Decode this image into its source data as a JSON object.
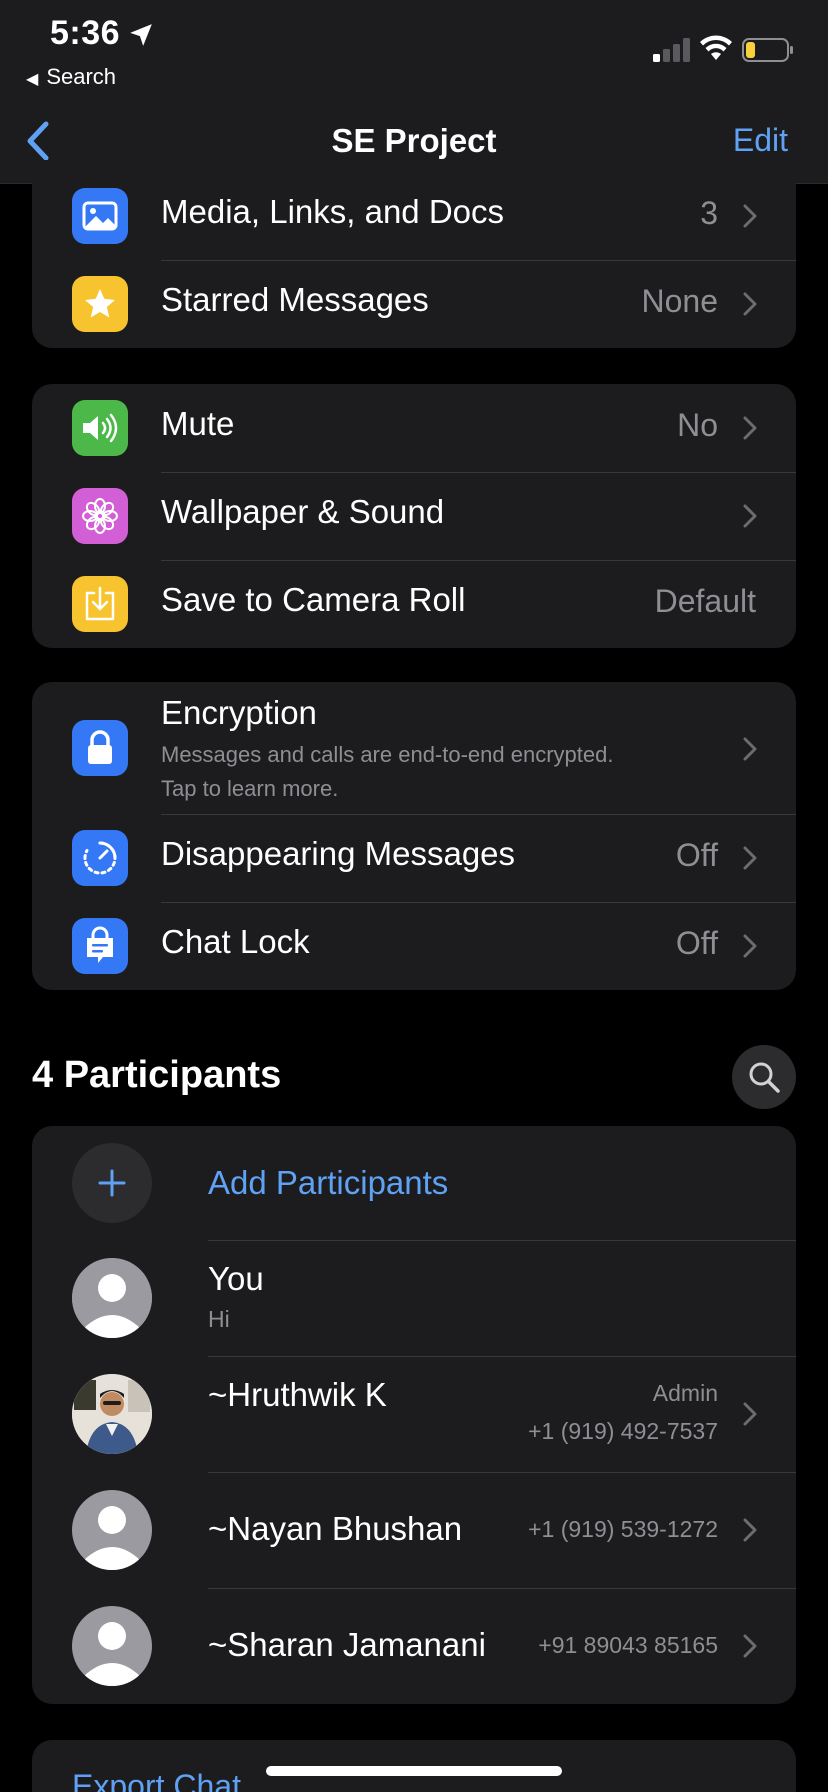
{
  "status_bar": {
    "time": "5:36",
    "back_app": "Search"
  },
  "nav": {
    "title": "SE Project",
    "edit": "Edit"
  },
  "group1": [
    {
      "label": "Media, Links, and Docs",
      "value": "3",
      "icon": "photo-icon",
      "color": "#3478f6"
    },
    {
      "label": "Starred Messages",
      "value": "None",
      "icon": "star-icon",
      "color": "#f7c32e"
    }
  ],
  "group2": [
    {
      "label": "Mute",
      "value": "No",
      "icon": "speaker-icon",
      "color": "#4cb84a"
    },
    {
      "label": "Wallpaper & Sound",
      "value": "",
      "icon": "flower-icon",
      "color": "#d35fd6"
    },
    {
      "label": "Save to Camera Roll",
      "value": "Default",
      "icon": "download-icon",
      "color": "#f7c32e"
    }
  ],
  "group3": {
    "encryption": {
      "label": "Encryption",
      "line1": "Messages and calls are end-to-end encrypted.",
      "line2": "Tap to learn more.",
      "icon": "lock-icon",
      "color": "#3478f6"
    },
    "disappearing": {
      "label": "Disappearing Messages",
      "value": "Off",
      "icon": "timer-icon",
      "color": "#3478f6"
    },
    "chat_lock": {
      "label": "Chat Lock",
      "value": "Off",
      "icon": "chat-lock-icon",
      "color": "#3478f6"
    }
  },
  "participants": {
    "title": "4 Participants",
    "add_label": "Add Participants",
    "members": [
      {
        "name": "You",
        "sub": "Hi"
      },
      {
        "name": "~Hruthwik K",
        "role": "Admin",
        "phone": "+1 (919) 492-7537"
      },
      {
        "name": "~Nayan Bhushan",
        "phone": "+1 (919) 539-1272"
      },
      {
        "name": "~Sharan Jamanani",
        "phone": "+91 89043 85165"
      }
    ]
  },
  "export_label": "Export Chat",
  "colors": {
    "accent": "#5fa1f2",
    "cell": "#1c1c1e",
    "background": "#000000"
  }
}
